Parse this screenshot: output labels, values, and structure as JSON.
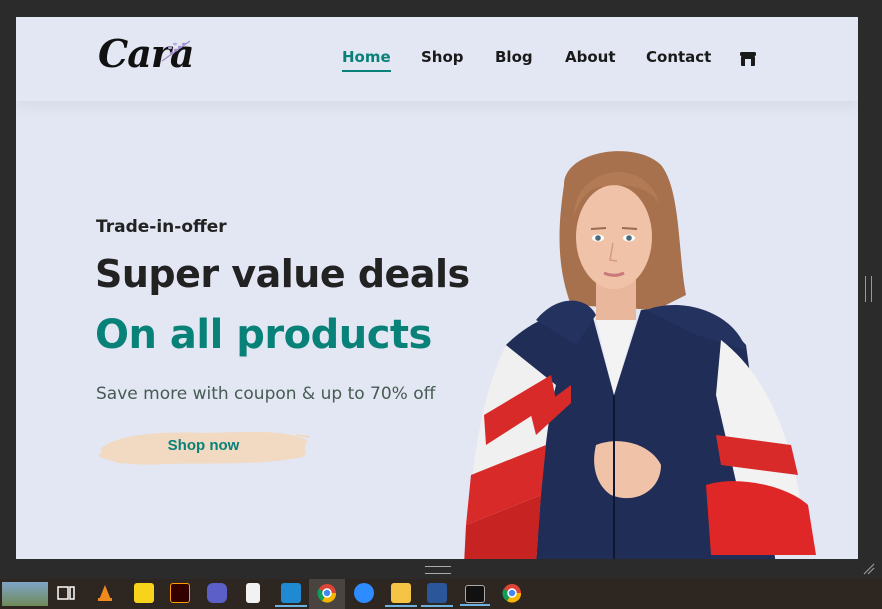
{
  "nav": {
    "logo_text": "Cara",
    "items": [
      {
        "label": "Home",
        "active": true
      },
      {
        "label": "Shop",
        "active": false
      },
      {
        "label": "Blog",
        "active": false
      },
      {
        "label": "About",
        "active": false
      },
      {
        "label": "Contact",
        "active": false
      }
    ],
    "cart_icon": "shop-bag-icon"
  },
  "hero": {
    "eyebrow": "Trade-in-offer",
    "headline": "Super value deals",
    "highlight": "On all products",
    "subtext": "Save more with coupon & up to 70% off",
    "cta_label": "Shop now"
  },
  "colors": {
    "accent": "#088178",
    "background": "#e3e6f3",
    "button_brush": "#f2d9c2",
    "heading": "#222222"
  },
  "taskbar": {
    "icons": [
      "landscape-thumb-icon",
      "task-view-icon",
      "vlc-icon",
      "sticky-notes-icon",
      "illustrator-icon",
      "teams-icon",
      "file-icon",
      "vscode-icon",
      "chrome-icon",
      "zoom-icon",
      "file-explorer-icon",
      "word-icon",
      "terminal-icon",
      "chrome-icon"
    ]
  }
}
